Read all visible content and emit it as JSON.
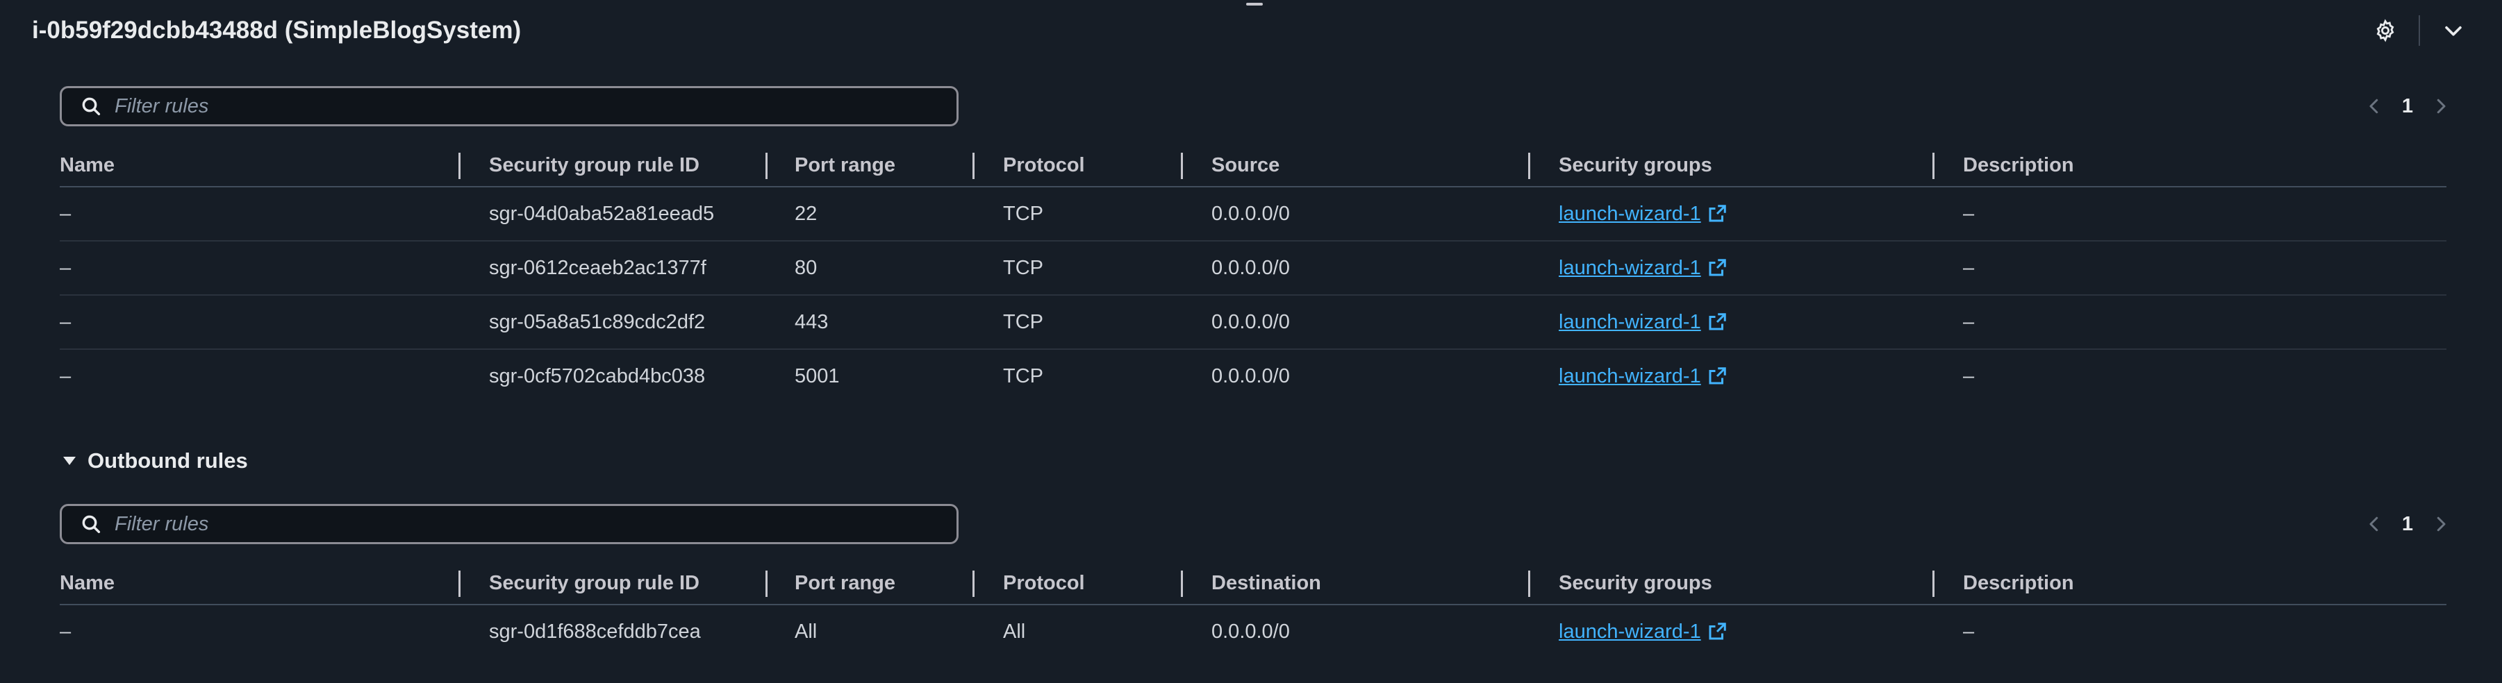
{
  "header": {
    "title": "i-0b59f29dcbb43488d (SimpleBlogSystem)",
    "settings_icon": "gear-icon",
    "collapse_icon": "chevron-down-icon"
  },
  "inbound": {
    "filter_placeholder": "Filter rules",
    "page": "1",
    "columns": [
      "Name",
      "Security group rule ID",
      "Port range",
      "Protocol",
      "Source",
      "Security groups",
      "Description"
    ],
    "rows": [
      {
        "name": "–",
        "rule_id": "sgr-04d0aba52a81eead5",
        "port": "22",
        "protocol": "TCP",
        "source": "0.0.0.0/0",
        "group": "launch-wizard-1",
        "description": "–"
      },
      {
        "name": "–",
        "rule_id": "sgr-0612ceaeb2ac1377f",
        "port": "80",
        "protocol": "TCP",
        "source": "0.0.0.0/0",
        "group": "launch-wizard-1",
        "description": "–"
      },
      {
        "name": "–",
        "rule_id": "sgr-05a8a51c89cdc2df2",
        "port": "443",
        "protocol": "TCP",
        "source": "0.0.0.0/0",
        "group": "launch-wizard-1",
        "description": "–"
      },
      {
        "name": "–",
        "rule_id": "sgr-0cf5702cabd4bc038",
        "port": "5001",
        "protocol": "TCP",
        "source": "0.0.0.0/0",
        "group": "launch-wizard-1",
        "description": "–"
      }
    ]
  },
  "outbound": {
    "section_label": "Outbound rules",
    "filter_placeholder": "Filter rules",
    "page": "1",
    "columns": [
      "Name",
      "Security group rule ID",
      "Port range",
      "Protocol",
      "Destination",
      "Security groups",
      "Description"
    ],
    "rows": [
      {
        "name": "–",
        "rule_id": "sgr-0d1f688cefddb7cea",
        "port": "All",
        "protocol": "All",
        "source": "0.0.0.0/0",
        "group": "launch-wizard-1",
        "description": "–"
      }
    ]
  },
  "colors": {
    "background": "#161d26",
    "link": "#42b4ff",
    "header_text": "#c6c6cd"
  }
}
